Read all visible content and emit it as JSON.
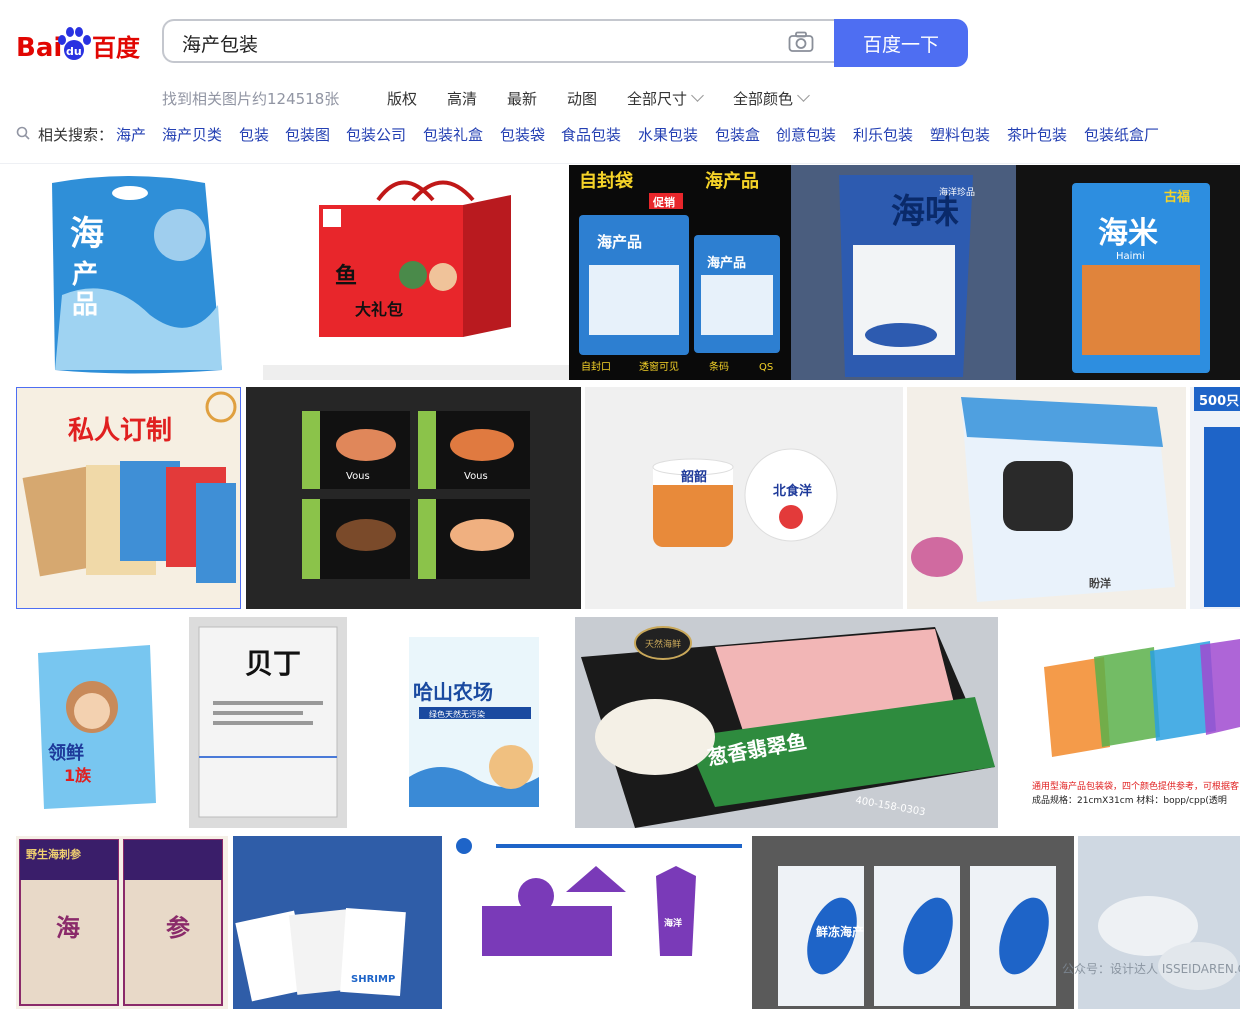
{
  "header": {
    "logo_text": "Bai du 百度",
    "search_query": "海产包装",
    "camera_icon": "camera-icon",
    "search_button": "百度一下"
  },
  "toolbar": {
    "result_count": "找到相关图片约124518张",
    "filters": [
      "版权",
      "高清",
      "最新",
      "动图",
      "全部尺寸",
      "全部颜色"
    ]
  },
  "related": {
    "label": "相关搜索：",
    "tags": [
      "海产",
      "海产贝类",
      "包装",
      "包装图",
      "包装公司",
      "包装礼盒",
      "包装袋",
      "食品包装",
      "水果包装",
      "包装盒",
      "创意包装",
      "利乐包装",
      "塑料包装",
      "茶叶包装",
      "包装纸盒厂"
    ]
  },
  "images": {
    "r1": {
      "a": {
        "t1": "海",
        "t2": "产",
        "t3": "品"
      },
      "b": {
        "t1": "鱼",
        "t2": "大礼包"
      },
      "c": {
        "top_l": "自封袋",
        "top_r": "海产品",
        "p1": "海产品",
        "p2": "海产品",
        "tag": "促销",
        "bottom": [
          "自封口",
          "透窗可见",
          "条码",
          "QS"
        ]
      },
      "d": {
        "t1": "海味",
        "t2": "海洋珍品"
      },
      "e": {
        "t1": "海米",
        "t2": "Haimi",
        "brand": "古福"
      }
    },
    "r2": {
      "a": {
        "t1": "私人订制"
      },
      "b": {
        "brand": "Vous"
      },
      "c": {
        "l1": "韶韶",
        "l2": "北食洋"
      },
      "d": {
        "brand": "盼洋"
      },
      "e": {
        "t1": "500只"
      }
    },
    "r3": {
      "a": {
        "t1": "领鲜",
        "t2": "1族"
      },
      "b": {
        "t1": "贝丁"
      },
      "c": {
        "t1": "哈山农场",
        "t2": "绿色天然无污染"
      },
      "d": {
        "t1": "葱香翡翠鱼",
        "t2": "天然海鲜",
        "phone": "400-158-0303"
      },
      "e": {
        "t1": "通用型海产品包装袋，四个颜色提供参考，可根据客",
        "t2": "成品规格：21cmX31cm 材料：bopp/cpp(透明"
      }
    },
    "r4": {
      "a": {
        "t1": "野生海刺参",
        "t2": "海",
        "t3": "参"
      },
      "b": {
        "t1": "SHRIMP"
      },
      "c": {
        "t1": "海洋"
      },
      "d": {
        "t1": "鲜冻海产"
      },
      "e": {
        "t1": "公众号：设计达人 ISSEIDAREN.COM"
      }
    }
  }
}
